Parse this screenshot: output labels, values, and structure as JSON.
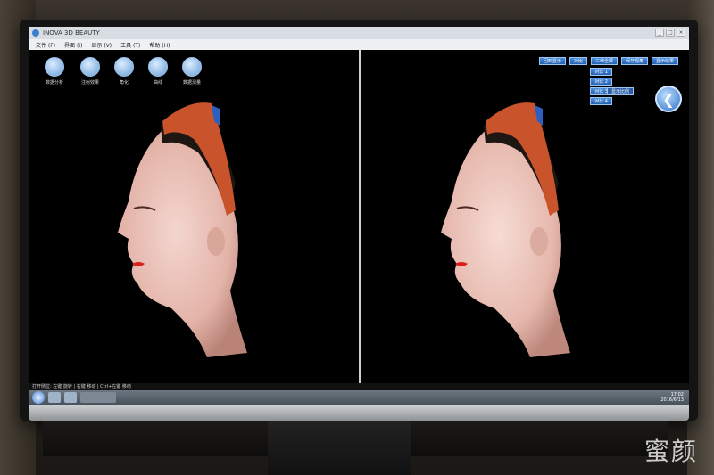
{
  "window": {
    "title": "INOVA 3D BEAUTY",
    "controls": [
      "_",
      "□",
      "×"
    ]
  },
  "menu": [
    "文件 (F)",
    "界面 (I)",
    "显示 (V)",
    "工具 (T)",
    "帮助 (H)"
  ],
  "toolbar": [
    {
      "label": "数据分析",
      "icon": "chart-icon"
    },
    {
      "label": "注射效果",
      "icon": "syringe-icon"
    },
    {
      "label": "角化",
      "icon": "edit-icon"
    },
    {
      "label": "曲线",
      "icon": "curve-icon"
    },
    {
      "label": "数据测量",
      "icon": "measure-icon"
    }
  ],
  "right_buttons_row1": [
    "回到显示",
    "对比",
    "三维全屏",
    "保存视角",
    "显示结果"
  ],
  "right_buttons_col": [
    "对比 1",
    "对比 2",
    "对比 3",
    "对比 4"
  ],
  "right_small_label": "显示比例",
  "status": "打开侧位: 左键 旋转 | 右键 移动 | Ctrl+左键 移动",
  "clock": {
    "time": "17:02",
    "date": "2016/6/13"
  },
  "watermark": "蜜颜"
}
